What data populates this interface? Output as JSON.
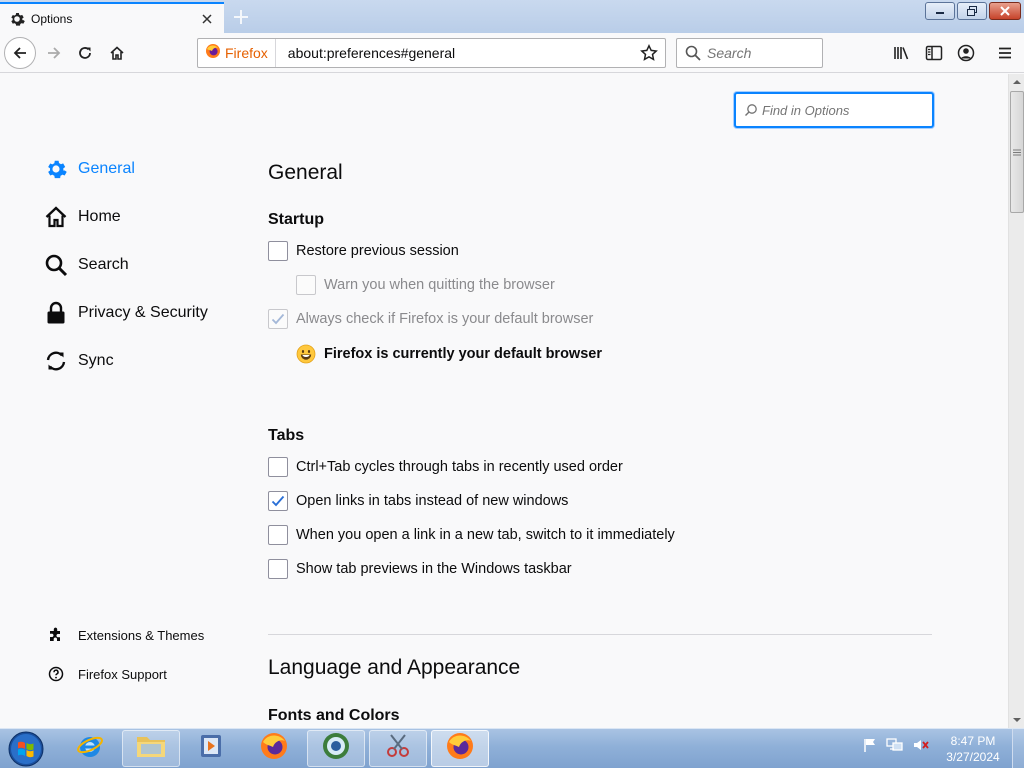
{
  "browser": {
    "tab": {
      "title": "Options"
    },
    "urlbar": {
      "identity_label": "Firefox",
      "url": "about:preferences#general"
    },
    "searchbar": {
      "placeholder": "Search"
    }
  },
  "preferences": {
    "find_placeholder": "Find in Options",
    "categories": [
      {
        "label": "General",
        "icon": "gear-icon",
        "selected": true
      },
      {
        "label": "Home",
        "icon": "home-icon",
        "selected": false
      },
      {
        "label": "Search",
        "icon": "search-icon",
        "selected": false
      },
      {
        "label": "Privacy & Security",
        "icon": "lock-icon",
        "selected": false
      },
      {
        "label": "Sync",
        "icon": "sync-icon",
        "selected": false
      }
    ],
    "footer_links": {
      "extensions": "Extensions & Themes",
      "support": "Firefox Support"
    },
    "general": {
      "heading": "General",
      "startup": {
        "heading": "Startup",
        "restore_session": {
          "label": "Restore previous session",
          "checked": false
        },
        "warn_quit": {
          "label": "Warn you when quitting the browser",
          "checked": false,
          "disabled": true
        },
        "default_check": {
          "label": "Always check if Firefox is your default browser",
          "checked": true,
          "disabled": true
        },
        "default_status": "Firefox is currently your default browser"
      },
      "tabs": {
        "heading": "Tabs",
        "ctrl_tab": {
          "label": "Ctrl+Tab cycles through tabs in recently used order",
          "checked": false
        },
        "open_links": {
          "label": "Open links in tabs instead of new windows",
          "checked": true
        },
        "switch_to": {
          "label": "When you open a link in a new tab, switch to it immediately",
          "checked": false
        },
        "tab_previews": {
          "label": "Show tab previews in the Windows taskbar",
          "checked": false
        }
      }
    },
    "language": {
      "heading": "Language and Appearance",
      "fonts_heading": "Fonts and Colors"
    }
  },
  "taskbar": {
    "time": "8:47 PM",
    "date": "3/27/2024"
  },
  "colors": {
    "accent": "#0a84ff",
    "background": "#f9f9fa",
    "taskbar": "#8fb0d8"
  }
}
